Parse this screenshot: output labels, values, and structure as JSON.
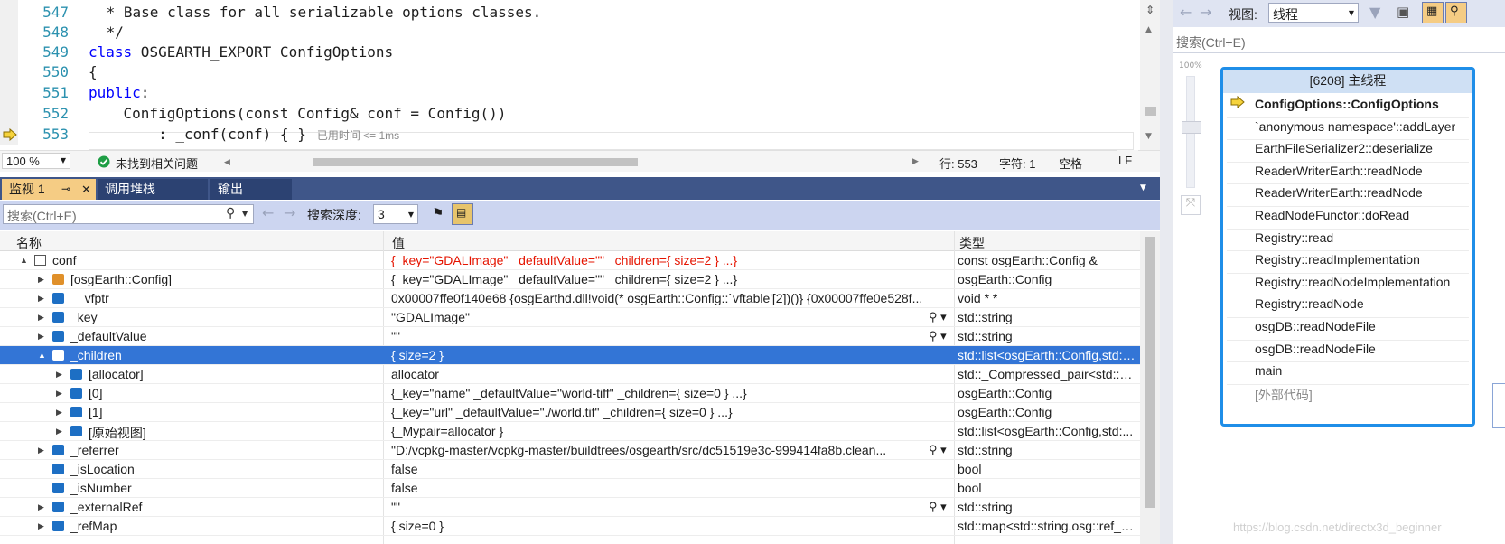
{
  "editor": {
    "lines": [
      {
        "num": "547",
        "text": " * Base class for all serializable options classes."
      },
      {
        "num": "548",
        "text": " */"
      },
      {
        "num": "549",
        "kw": "class",
        "text": " OSGEARTH_EXPORT ConfigOptions"
      },
      {
        "num": "550",
        "text": "{"
      },
      {
        "num": "551",
        "kw": "public",
        "text": ":"
      },
      {
        "num": "552",
        "text": "    ConfigOptions(const Config& conf = Config())"
      },
      {
        "num": "553",
        "text": "        : _conf(conf) { }"
      }
    ],
    "elapsed_hint": "已用时间 <= 1ms",
    "status": {
      "zoom": "100 %",
      "issues": "未找到相关问题",
      "line": "行: 553",
      "char": "字符: 1",
      "space": "空格",
      "eol": "LF"
    }
  },
  "tabs": [
    {
      "label": "监视 1",
      "active": true
    },
    {
      "label": "调用堆栈",
      "active": false
    },
    {
      "label": "输出",
      "active": false
    }
  ],
  "watch_toolbar": {
    "search_placeholder": "搜索(Ctrl+E)",
    "depth_label": "搜索深度:",
    "depth_value": "3"
  },
  "watch": {
    "columns": [
      "名称",
      "值",
      "类型"
    ],
    "rows": [
      {
        "name": "conf",
        "value": "{_key=\"GDALImage\" _defaultValue=\"\" _children={ size=2 } ...}",
        "type": "const osgEarth::Config &",
        "red": true
      },
      {
        "name": "[osgEarth::Config]",
        "value": "{_key=\"GDALImage\" _defaultValue=\"\" _children={ size=2 } ...}",
        "type": "osgEarth::Config"
      },
      {
        "name": "__vfptr",
        "value": "0x00007ffe0f140e68 {osgEarthd.dll!void(* osgEarth::Config::`vftable'[2])()} {0x00007ffe0e528f...",
        "type": "void * *"
      },
      {
        "name": "_key",
        "value": "\"GDALImage\"",
        "type": "std::string"
      },
      {
        "name": "_defaultValue",
        "value": "\"\"",
        "type": "std::string"
      },
      {
        "name": "_children",
        "value": "{ size=2 }",
        "type": "std::list<osgEarth::Config,std::...",
        "selected": true
      },
      {
        "name": "[allocator]",
        "value": "allocator",
        "type": "std::_Compressed_pair<std::al..."
      },
      {
        "name": "[0]",
        "value": "{_key=\"name\" _defaultValue=\"world-tiff\" _children={ size=0 } ...}",
        "type": "osgEarth::Config"
      },
      {
        "name": "[1]",
        "value": "{_key=\"url\" _defaultValue=\"./world.tif\" _children={ size=0 } ...}",
        "type": "osgEarth::Config"
      },
      {
        "name": "[原始视图]",
        "value": "{_Mypair=allocator }",
        "type": "std::list<osgEarth::Config,std:..."
      },
      {
        "name": "_referrer",
        "value": "\"D:/vcpkg-master/vcpkg-master/buildtrees/osgearth/src/dc51519e3c-999414fa8b.clean...",
        "type": "std::string"
      },
      {
        "name": "_isLocation",
        "value": "false",
        "type": "bool"
      },
      {
        "name": "_isNumber",
        "value": "false",
        "type": "bool"
      },
      {
        "name": "_externalRef",
        "value": "\"\"",
        "type": "std::string"
      },
      {
        "name": "_refMap",
        "value": "{ size=0 }",
        "type": "std::map<std::string,osg::ref_p..."
      }
    ]
  },
  "parallel_stacks": {
    "view_label": "视图:",
    "view_value": "线程",
    "search_placeholder": "搜索(Ctrl+E)",
    "zoom": "100%",
    "thread_title": "[6208] 主线程",
    "frames": [
      "ConfigOptions::ConfigOptions",
      "`anonymous namespace'::addLayer",
      "EarthFileSerializer2::deserialize",
      "ReaderWriterEarth::readNode",
      "ReaderWriterEarth::readNode",
      "ReadNodeFunctor::doRead",
      "Registry::read",
      "Registry::readImplementation",
      "Registry::readNodeImplementation",
      "Registry::readNode",
      "osgDB::readNodeFile",
      "osgDB::readNodeFile",
      "main",
      "[外部代码]"
    ]
  },
  "watermark": "https://blog.csdn.net/directx3d_beginner",
  "colors": {
    "tab_bar": "#3f5689",
    "active_tab": "#f5cc84",
    "selection": "#3375d6",
    "error_value": "#e51400",
    "stack_border": "#1f8ee8"
  }
}
